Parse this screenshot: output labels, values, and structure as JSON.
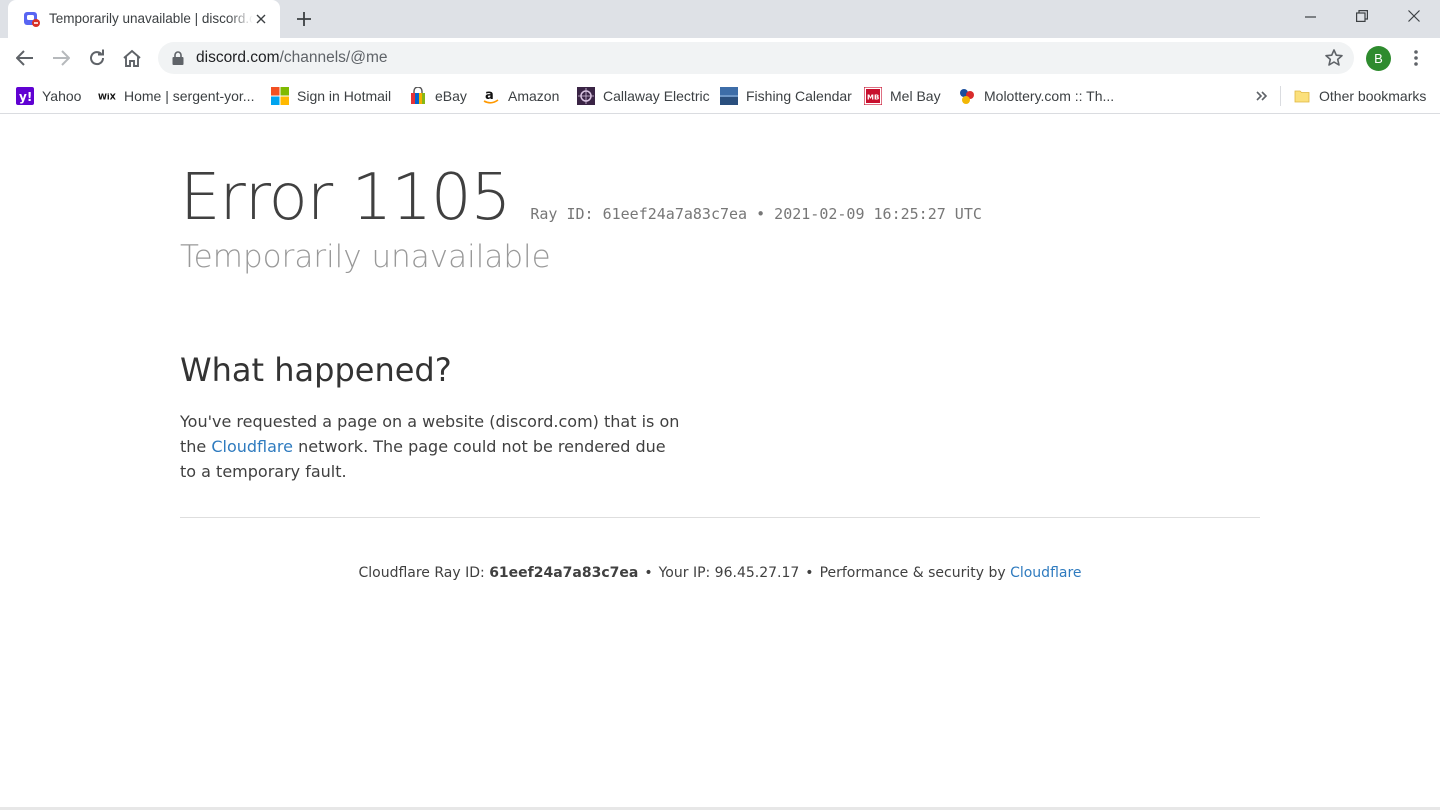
{
  "tab": {
    "title": "Temporarily unavailable | discord.com | Cloudflare",
    "close_icon": "close-icon",
    "favicon": "discord-favicon"
  },
  "toolbar": {
    "url_host": "discord.com",
    "url_path": "/channels/@me",
    "profile_initial": "B",
    "profile_color": "#2e8b2e"
  },
  "bookmarks": [
    {
      "label": "Yahoo",
      "icon": "yahoo-icon"
    },
    {
      "label": "Home | sergent-yor...",
      "icon": "wix-icon"
    },
    {
      "label": "Sign in Hotmail",
      "icon": "microsoft-icon"
    },
    {
      "label": "eBay",
      "icon": "ebay-icon"
    },
    {
      "label": "Amazon",
      "icon": "amazon-icon"
    },
    {
      "label": "Callaway Electric",
      "icon": "callaway-icon"
    },
    {
      "label": "Fishing Calendar",
      "icon": "fishing-icon"
    },
    {
      "label": "Mel Bay",
      "icon": "melbay-icon"
    },
    {
      "label": "Molottery.com :: Th...",
      "icon": "molottery-icon"
    }
  ],
  "other_bookmarks": "Other bookmarks",
  "error": {
    "code": "Error 1105",
    "ray_line": "Ray ID: 61eef24a7a83c7ea • 2021-02-09 16:25:27 UTC",
    "subtitle": "Temporarily unavailable"
  },
  "what_happened": {
    "heading": "What happened?",
    "text_before": "You've requested a page on a website (discord.com) that is on the ",
    "link": "Cloudflare",
    "text_after": " network. The page could not be rendered due to a temporary fault."
  },
  "footer": {
    "ray_label": "Cloudflare Ray ID: ",
    "ray_id": "61eef24a7a83c7ea",
    "bullet": "•",
    "ip": "Your IP: 96.45.27.17",
    "perf": "Performance & security by ",
    "perf_link": "Cloudflare"
  },
  "colors": {
    "link": "#2f7bbf",
    "tabstrip": "#dee1e6"
  }
}
